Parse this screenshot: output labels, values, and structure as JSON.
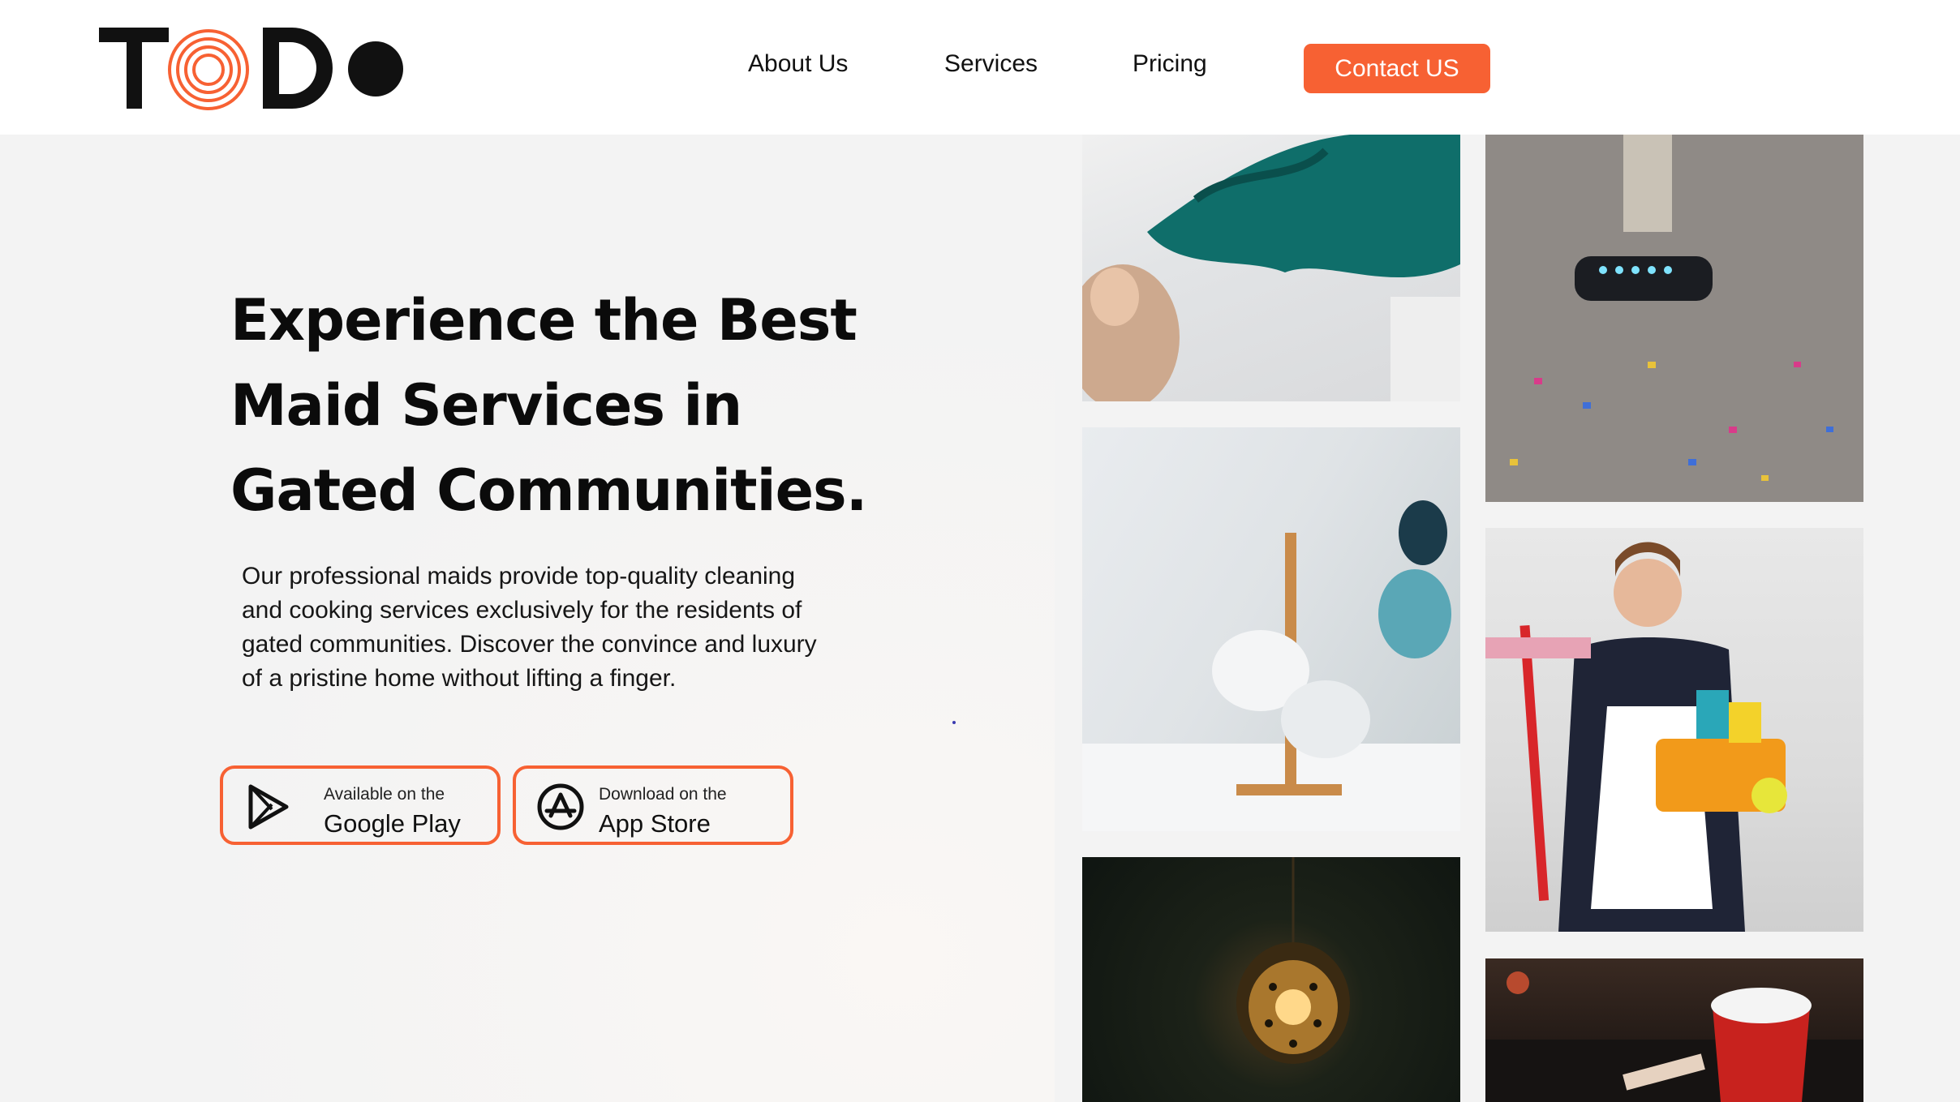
{
  "brand": {
    "logo_text": "TODO",
    "accent_color": "#f76133"
  },
  "nav": {
    "about": "About Us",
    "services": "Services",
    "pricing": "Pricing",
    "contact": "Contact US"
  },
  "hero": {
    "title_lines": [
      "Experience the Best",
      "Maid Services in",
      "Gated Communities."
    ],
    "description": "Our professional maids  provide top-quality cleaning and cooking services exclusively for the residents of gated communities. Discover the convince and luxury of a pristine home without lifting a finger."
  },
  "store_buttons": {
    "google": {
      "small": "Available on the",
      "big": "Google Play",
      "icon": "google-play-icon"
    },
    "apple": {
      "small": "Download on the",
      "big": "App Store",
      "icon": "app-store-icon"
    }
  },
  "gallery": [
    {
      "subject": "woman spreading green sheet"
    },
    {
      "subject": "vacuum cleaning confetti carpet"
    },
    {
      "subject": "mugs on wooden rack"
    },
    {
      "subject": "maid holding cleaning supplies"
    },
    {
      "subject": "hanging lantern at night"
    },
    {
      "subject": "red bucket with soap"
    }
  ]
}
